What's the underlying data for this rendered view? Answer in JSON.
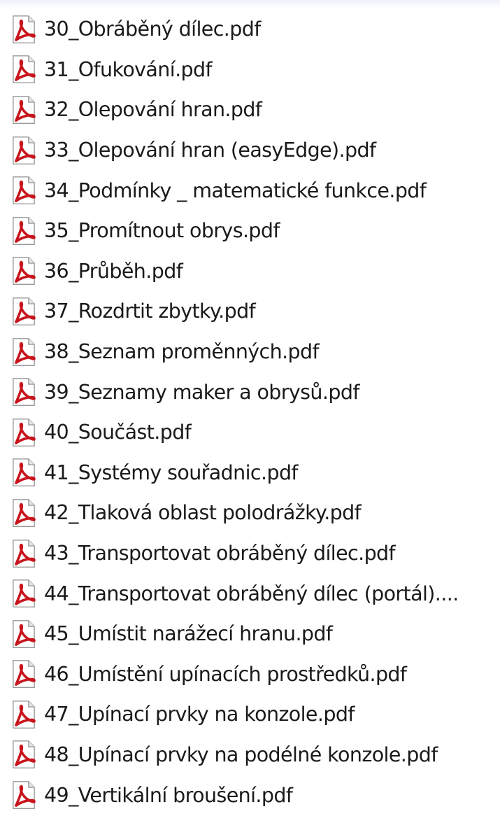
{
  "file_list": {
    "icon": "pdf-file-icon",
    "icon_color": "#c8141c",
    "items": [
      {
        "name": "30_Obráběný dílec.pdf"
      },
      {
        "name": "31_Ofukování.pdf"
      },
      {
        "name": "32_Olepování hran.pdf"
      },
      {
        "name": "33_Olepování hran (easyEdge).pdf"
      },
      {
        "name": "34_Podmínky _ matematické funkce.pdf"
      },
      {
        "name": "35_Promítnout obrys.pdf"
      },
      {
        "name": "36_Průběh.pdf"
      },
      {
        "name": "37_Rozdrtit zbytky.pdf"
      },
      {
        "name": "38_Seznam proměnných.pdf"
      },
      {
        "name": "39_Seznamy maker a obrysů.pdf"
      },
      {
        "name": "40_Součást.pdf"
      },
      {
        "name": "41_Systémy souřadnic.pdf"
      },
      {
        "name": "42_Tlaková oblast polodrážky.pdf"
      },
      {
        "name": "43_Transportovat obráběný dílec.pdf"
      },
      {
        "name": "44_Transportovat obráběný dílec (portál)...."
      },
      {
        "name": "45_Umístit narážecí hranu.pdf"
      },
      {
        "name": "46_Umístění upínacích prostředků.pdf"
      },
      {
        "name": "47_Upínací prvky na konzole.pdf"
      },
      {
        "name": "48_Upínací prvky na podélné konzole.pdf"
      },
      {
        "name": "49_Vertikální broušení.pdf"
      }
    ]
  }
}
